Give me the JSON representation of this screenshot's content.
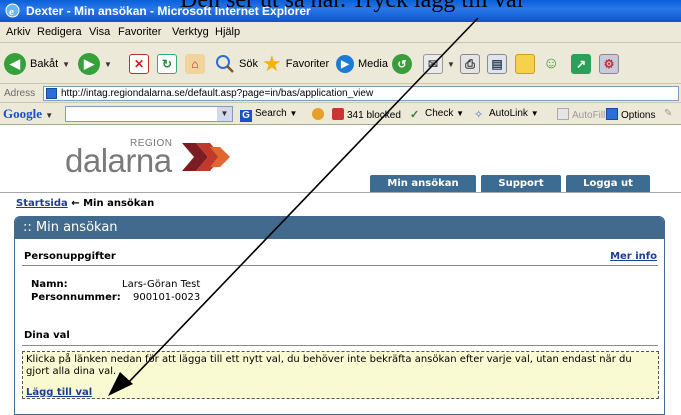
{
  "caption": "Den ser ut så här. Tryck lägg till val",
  "window": {
    "title": "Dexter - Min ansökan - Microsoft Internet Explorer"
  },
  "menu": {
    "items": [
      "Arkiv",
      "Redigera",
      "Visa",
      "Favoriter",
      "Verktyg",
      "Hjälp"
    ]
  },
  "toolbar": {
    "back_label": "Bakåt",
    "search_label": "Sök",
    "favorites_label": "Favoriter",
    "media_label": "Media"
  },
  "address": {
    "label": "Adress",
    "url": "http://intag.regiondalarna.se/default.asp?page=in/bas/application_view"
  },
  "google_bar": {
    "logo": "Google",
    "search_label": "Search",
    "blocked_label": "341 blocked",
    "check_label": "Check",
    "autolink_label": "AutoLink",
    "autofill_label": "AutoFill",
    "options_label": "Options"
  },
  "site": {
    "logo_region": "REGION",
    "logo_name": "dalarna",
    "nav": [
      "Min ansökan",
      "Support",
      "Logga ut"
    ]
  },
  "breadcrumb": {
    "home": "Startsida",
    "separator": "←",
    "current": "Min ansökan"
  },
  "panel": {
    "title": ":: Min ansökan",
    "personal": {
      "heading": "Personuppgifter",
      "more_info": "Mer info",
      "name_label": "Namn:",
      "name_value": "Lars-Göran Test",
      "pnr_label": "Personnummer:",
      "pnr_value": "900101-0023"
    },
    "choices": {
      "heading": "Dina val",
      "info_text": "Klicka på länken nedan för att lägga till ett nytt val, du behöver inte bekräfta ansökan efter varje val, utan endast när du gjort alla dina val.",
      "add_link": "Lägg till val"
    }
  },
  "colors": {
    "panel_blue": "#416a8e",
    "link_blue": "#1c3f94",
    "info_bg": "#fafad2",
    "logo_red": "#c0392b"
  }
}
